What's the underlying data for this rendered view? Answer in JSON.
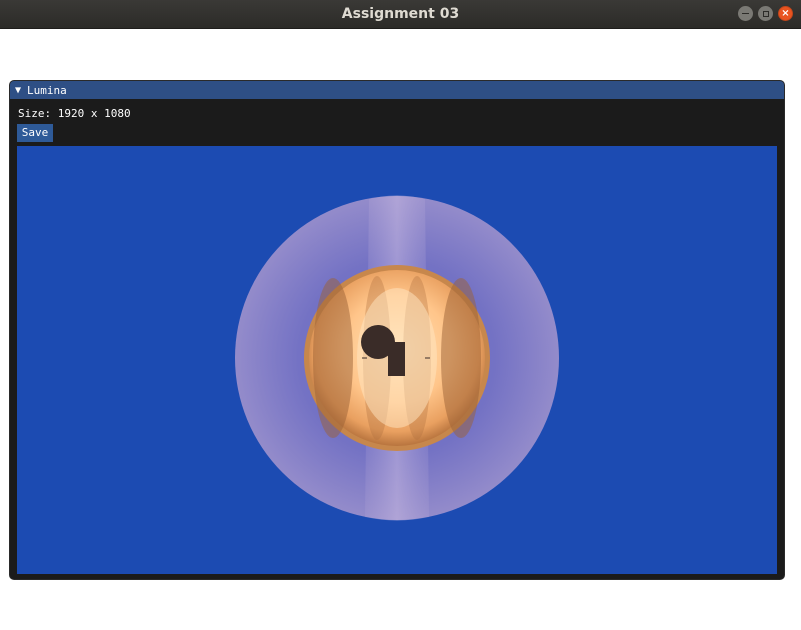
{
  "window": {
    "title": "Assignment 03",
    "controls": {
      "minimize": "–",
      "maximize": "□",
      "close": "×"
    }
  },
  "panel": {
    "title": "Lumina",
    "collapse_glyph": "▼",
    "size_text": "Size: 1920 x 1080",
    "save_label": "Save"
  },
  "colors": {
    "viewport_background": "#1c4bb2",
    "panel_titlebar": "#2e4f85",
    "outer_sphere": "#8f86c9",
    "inner_sphere": "#ffb068",
    "dark_object": "#3a2c28"
  }
}
